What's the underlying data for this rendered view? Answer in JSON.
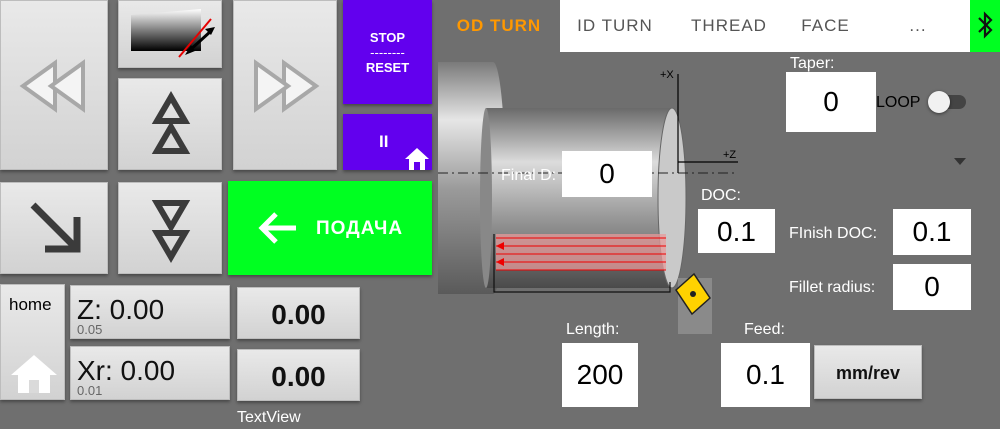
{
  "controls": {
    "stop_label": "STOP",
    "stop_sep": "--------",
    "reset_label": "RESET",
    "pause_glyph": "II",
    "feed_button_label": "ПОДАЧА",
    "home_label": "home",
    "z_label": "Z: 0.00",
    "z_sub": "0.05",
    "z_value": "0.00",
    "xr_label": "Xr: 0.00",
    "xr_sub": "0.01",
    "xr_value": "0.00",
    "textview_label": "TextView"
  },
  "tabs": [
    {
      "label": "OD TURN",
      "active": true
    },
    {
      "label": "ID TURN",
      "active": false
    },
    {
      "label": "THREAD",
      "active": false
    },
    {
      "label": "FACE",
      "active": false
    },
    {
      "label": "...",
      "active": false
    }
  ],
  "params": {
    "taper_label": "Taper:",
    "taper_value": "0",
    "loop_label": "LOOP",
    "loop_on": false,
    "final_d_label": "Final D:",
    "final_d_value": "0",
    "doc_label": "DOC:",
    "doc_value": "0.1",
    "finish_doc_label": "FInish DOC:",
    "finish_doc_value": "0.1",
    "fillet_label": "Fillet radius:",
    "fillet_value": "0",
    "length_label": "Length:",
    "length_value": "200",
    "feed_label": "Feed:",
    "feed_value": "0.1",
    "feed_unit": "mm/rev"
  },
  "diagram": {
    "axis_x": "+X",
    "axis_z": "+Z"
  },
  "colors": {
    "accent_orange": "#ff9800",
    "purple": "#6200ee",
    "green": "#00ff21",
    "background": "#6f6f6f"
  },
  "icons": [
    "rewind-icon",
    "fast-forward-icon",
    "taper-icon",
    "up-arrows-icon",
    "down-arrows-icon",
    "diagonal-arrow-icon",
    "home-icon",
    "bluetooth-icon",
    "dropdown-icon",
    "arrow-left-icon",
    "pause-icon"
  ]
}
